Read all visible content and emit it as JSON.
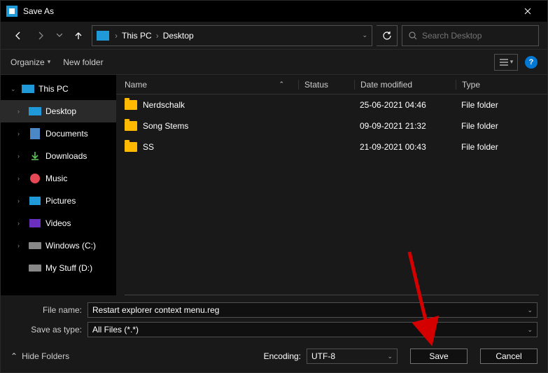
{
  "titlebar": {
    "title": "Save As"
  },
  "breadcrumb": {
    "root": "This PC",
    "current": "Desktop"
  },
  "search": {
    "placeholder": "Search Desktop"
  },
  "toolbar": {
    "organize": "Organize",
    "new_folder": "New folder"
  },
  "sidebar": {
    "items": [
      {
        "label": "This PC",
        "icon": "pc"
      },
      {
        "label": "Desktop",
        "icon": "desktop"
      },
      {
        "label": "Documents",
        "icon": "documents"
      },
      {
        "label": "Downloads",
        "icon": "downloads"
      },
      {
        "label": "Music",
        "icon": "music"
      },
      {
        "label": "Pictures",
        "icon": "pictures"
      },
      {
        "label": "Videos",
        "icon": "videos"
      },
      {
        "label": "Windows (C:)",
        "icon": "drive"
      },
      {
        "label": "My Stuff (D:)",
        "icon": "drive"
      }
    ]
  },
  "columns": {
    "name": "Name",
    "status": "Status",
    "date": "Date modified",
    "type": "Type"
  },
  "files": [
    {
      "name": "Nerdschalk",
      "date": "25-06-2021 04:46",
      "type": "File folder"
    },
    {
      "name": "Song Stems",
      "date": "09-09-2021 21:32",
      "type": "File folder"
    },
    {
      "name": "SS",
      "date": "21-09-2021 00:43",
      "type": "File folder"
    }
  ],
  "form": {
    "file_name_label": "File name:",
    "file_name_value": "Restart explorer context menu.reg",
    "type_label": "Save as type:",
    "type_value": "All Files  (*.*)"
  },
  "encoding": {
    "label": "Encoding:",
    "value": "UTF-8"
  },
  "actions": {
    "hide_folders": "Hide Folders",
    "save": "Save",
    "cancel": "Cancel"
  }
}
